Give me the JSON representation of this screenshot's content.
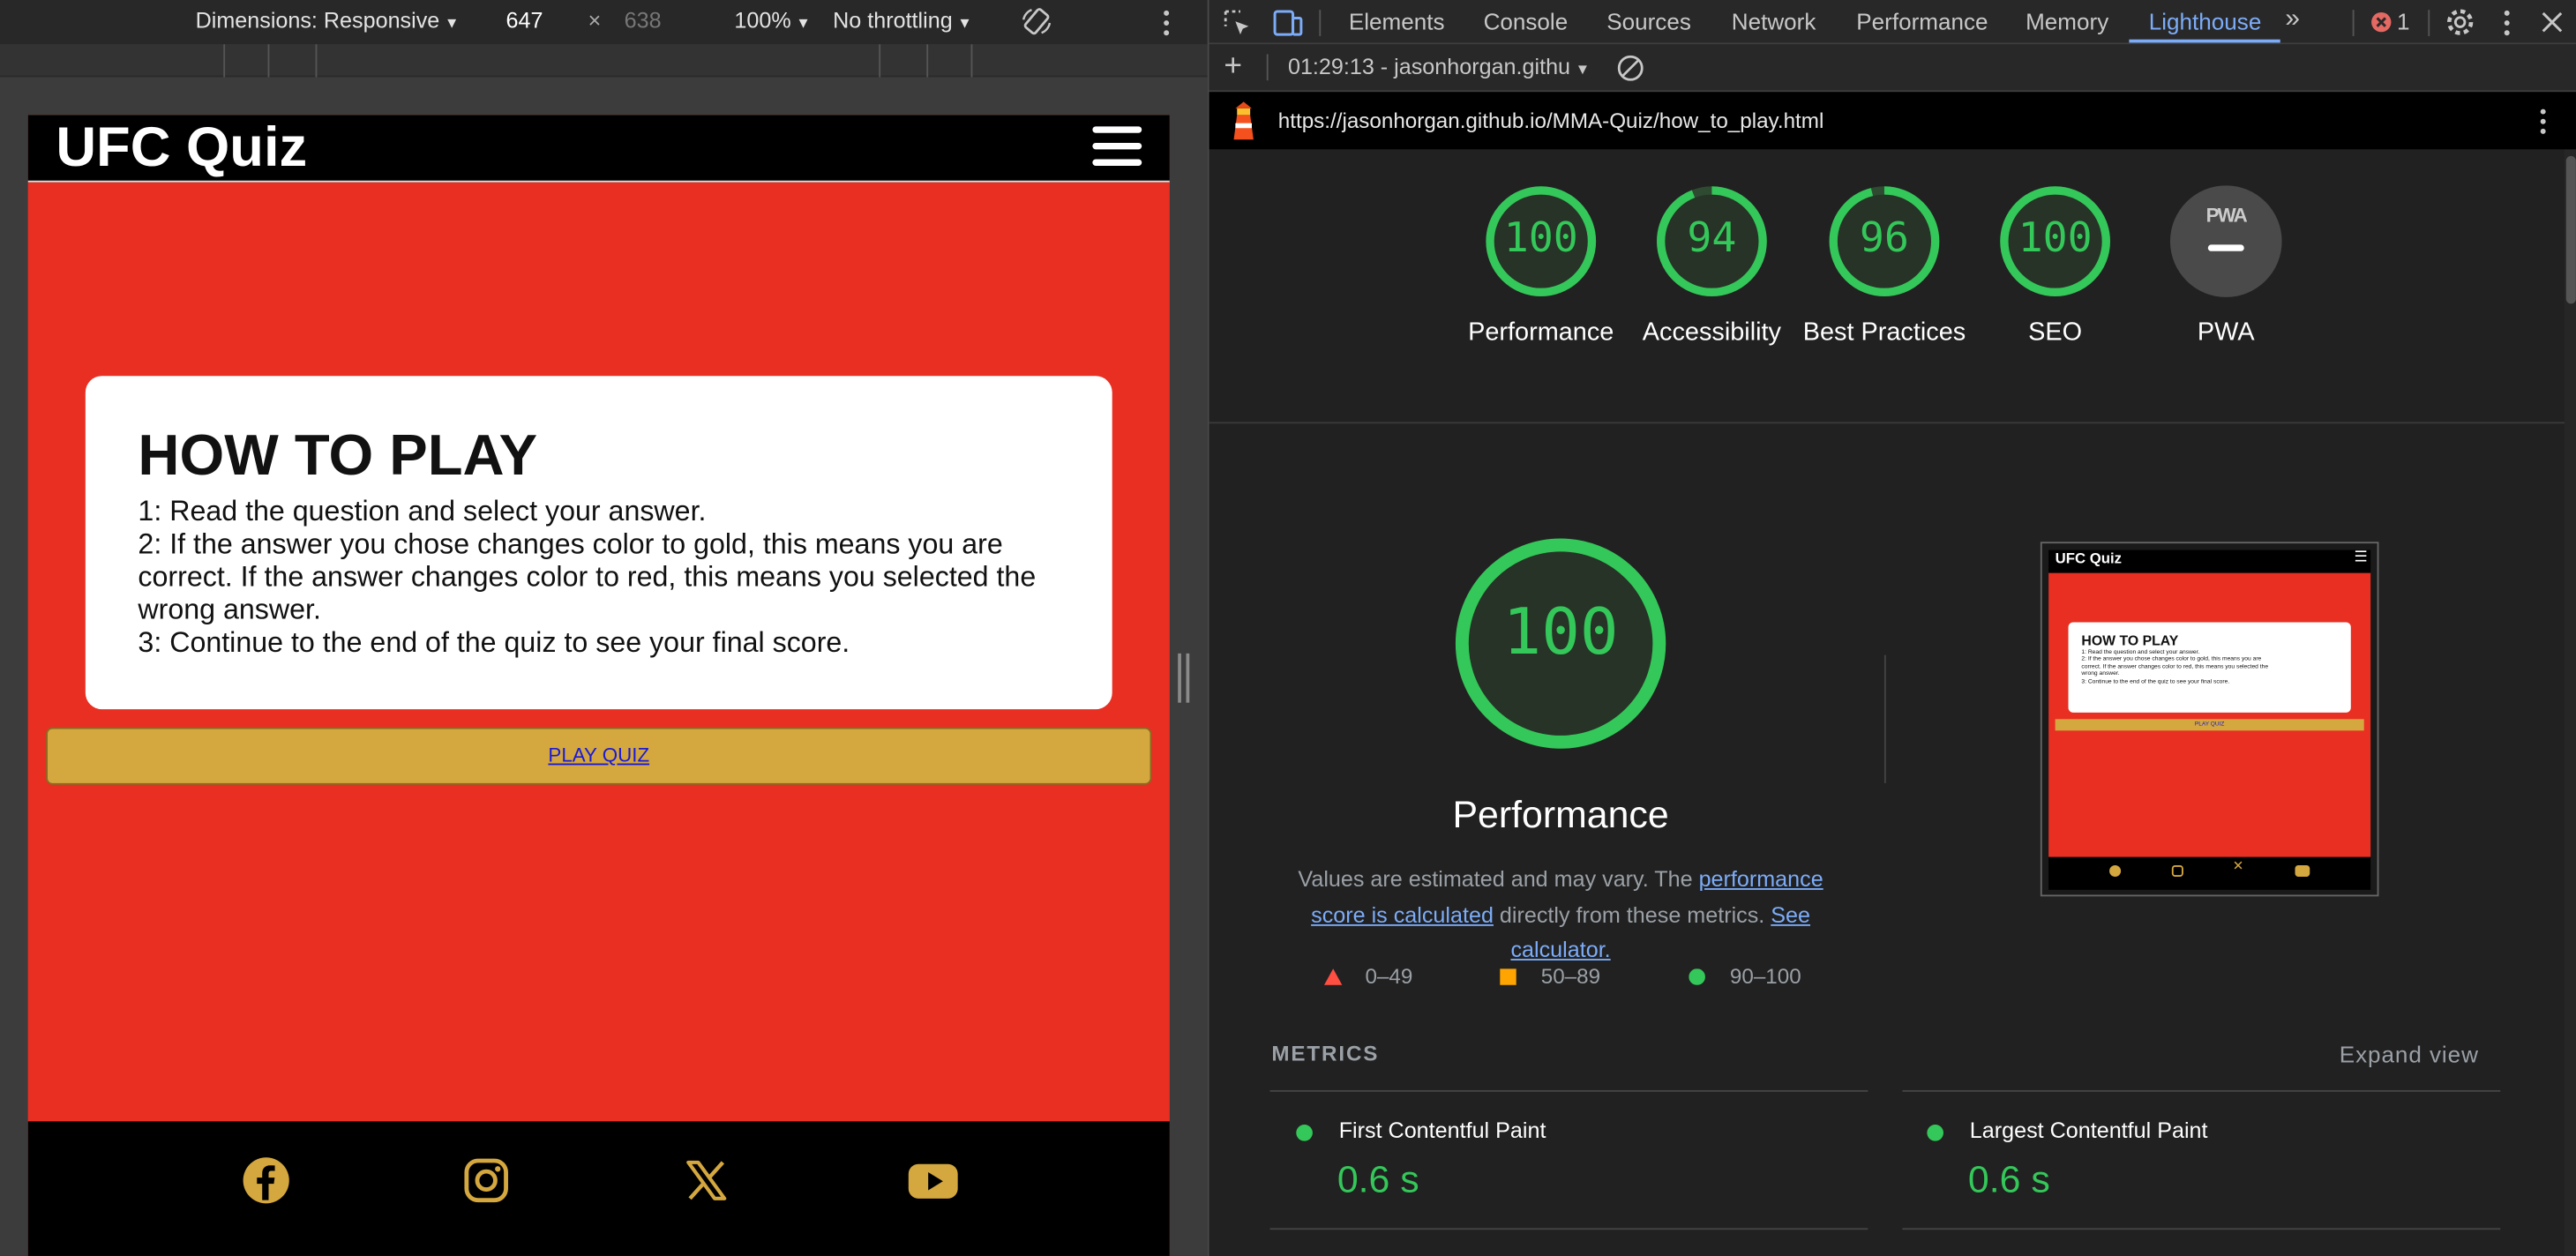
{
  "emulation": {
    "dimensions_label": "Dimensions: Responsive",
    "width": "647",
    "times": "×",
    "height": "638",
    "zoom": "100%",
    "throttling": "No throttling"
  },
  "site": {
    "title": "UFC Quiz",
    "card_heading": "HOW TO PLAY",
    "instructions": [
      "1: Read the question and select your answer.",
      "2: If the answer you chose changes color to gold, this means you are correct. If the answer changes color to red, this means you selected the wrong answer.",
      "3: Continue to the end of the quiz to see your final score."
    ],
    "play_button": "PLAY QUIZ",
    "colors": {
      "background": "#e82f22",
      "button": "#d4a73f",
      "social": "#d4a73f"
    },
    "social_icons": [
      "facebook-icon",
      "instagram-icon",
      "x-icon",
      "youtube-icon"
    ]
  },
  "devtools": {
    "tabs": [
      "Elements",
      "Console",
      "Sources",
      "Network",
      "Performance",
      "Memory",
      "Lighthouse"
    ],
    "active_tab": "Lighthouse",
    "error_count": "1",
    "report_selector": "01:29:13 - jasonhorgan.githu",
    "url": "https://jasonhorgan.github.io/MMA-Quiz/how_to_play.html",
    "scores": [
      {
        "value": "100",
        "label": "Performance",
        "score": 100
      },
      {
        "value": "94",
        "label": "Accessibility",
        "score": 94
      },
      {
        "value": "96",
        "label": "Best Practices",
        "score": 96
      },
      {
        "value": "100",
        "label": "SEO",
        "score": 100
      }
    ],
    "pwa": {
      "badge": "PWA",
      "label": "PWA"
    },
    "performance": {
      "score": "100",
      "title": "Performance",
      "desc_prefix": "Values are estimated and may vary. The ",
      "desc_link1": "performance score is calculated",
      "desc_mid": " directly from these metrics. ",
      "desc_link2": "See calculator."
    },
    "legend": [
      {
        "range": "0–49",
        "color": "#ff4e42"
      },
      {
        "range": "50–89",
        "color": "#ffa400"
      },
      {
        "range": "90–100",
        "color": "#34c759"
      }
    ],
    "thumbnail": {
      "title": "UFC Quiz",
      "heading": "HOW TO PLAY",
      "lines": [
        "1: Read the question and select your answer.",
        "2: If the answer you chose changes color to gold, this means you are",
        "correct. If the answer changes color to red, this means you selected the",
        "wrong answer.",
        "3: Continue to the end of the quiz to see your final score."
      ],
      "button": "PLAY QUIZ"
    },
    "metrics_heading": "METRICS",
    "expand_view": "Expand view",
    "metrics": [
      {
        "name": "First Contentful Paint",
        "value": "0.6 s"
      },
      {
        "name": "Largest Contentful Paint",
        "value": "0.6 s"
      }
    ]
  }
}
